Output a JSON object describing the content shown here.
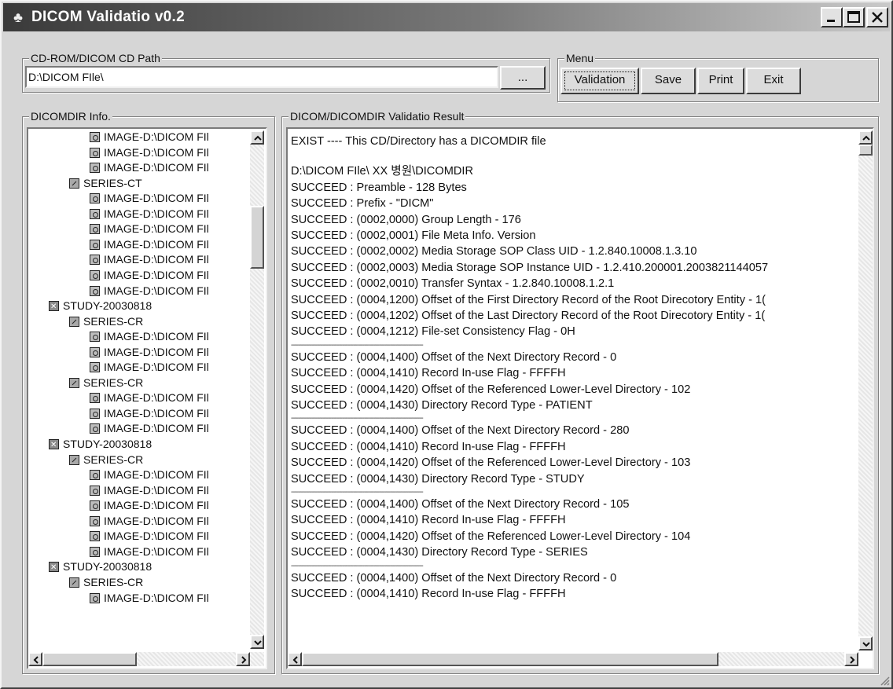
{
  "window": {
    "title": "DICOM Validatio v0.2"
  },
  "path_group": {
    "label": "CD-ROM/DICOM CD Path",
    "path_value": "D:\\DICOM FIle\\",
    "browse_label": "..."
  },
  "menu_group": {
    "label": "Menu",
    "validation_label": "Validation",
    "save_label": "Save",
    "print_label": "Print",
    "exit_label": "Exit"
  },
  "dicomdir_group": {
    "label": "DICOMDIR Info.",
    "items": [
      {
        "type": "image",
        "indent": 2,
        "label": "IMAGE-D:\\DICOM FIl"
      },
      {
        "type": "image",
        "indent": 2,
        "label": "IMAGE-D:\\DICOM FIl"
      },
      {
        "type": "image",
        "indent": 2,
        "label": "IMAGE-D:\\DICOM FIl"
      },
      {
        "type": "series",
        "indent": 1,
        "label": "SERIES-CT"
      },
      {
        "type": "image",
        "indent": 2,
        "label": "IMAGE-D:\\DICOM FIl"
      },
      {
        "type": "image",
        "indent": 2,
        "label": "IMAGE-D:\\DICOM FIl"
      },
      {
        "type": "image",
        "indent": 2,
        "label": "IMAGE-D:\\DICOM FIl"
      },
      {
        "type": "image",
        "indent": 2,
        "label": "IMAGE-D:\\DICOM FIl"
      },
      {
        "type": "image",
        "indent": 2,
        "label": "IMAGE-D:\\DICOM FIl"
      },
      {
        "type": "image",
        "indent": 2,
        "label": "IMAGE-D:\\DICOM FIl"
      },
      {
        "type": "image",
        "indent": 2,
        "label": "IMAGE-D:\\DICOM FIl"
      },
      {
        "type": "study",
        "indent": 0,
        "label": "STUDY-20030818"
      },
      {
        "type": "series",
        "indent": 1,
        "label": "SERIES-CR"
      },
      {
        "type": "image",
        "indent": 2,
        "label": "IMAGE-D:\\DICOM FIl"
      },
      {
        "type": "image",
        "indent": 2,
        "label": "IMAGE-D:\\DICOM FIl"
      },
      {
        "type": "image",
        "indent": 2,
        "label": "IMAGE-D:\\DICOM FIl"
      },
      {
        "type": "series",
        "indent": 1,
        "label": "SERIES-CR"
      },
      {
        "type": "image",
        "indent": 2,
        "label": "IMAGE-D:\\DICOM FIl"
      },
      {
        "type": "image",
        "indent": 2,
        "label": "IMAGE-D:\\DICOM FIl"
      },
      {
        "type": "image",
        "indent": 2,
        "label": "IMAGE-D:\\DICOM FIl"
      },
      {
        "type": "study",
        "indent": 0,
        "label": "STUDY-20030818"
      },
      {
        "type": "series",
        "indent": 1,
        "label": "SERIES-CR"
      },
      {
        "type": "image",
        "indent": 2,
        "label": "IMAGE-D:\\DICOM FIl"
      },
      {
        "type": "image",
        "indent": 2,
        "label": "IMAGE-D:\\DICOM FIl"
      },
      {
        "type": "image",
        "indent": 2,
        "label": "IMAGE-D:\\DICOM FIl"
      },
      {
        "type": "image",
        "indent": 2,
        "label": "IMAGE-D:\\DICOM FIl"
      },
      {
        "type": "image",
        "indent": 2,
        "label": "IMAGE-D:\\DICOM FIl"
      },
      {
        "type": "image",
        "indent": 2,
        "label": "IMAGE-D:\\DICOM FIl"
      },
      {
        "type": "study",
        "indent": 0,
        "label": "STUDY-20030818"
      },
      {
        "type": "series",
        "indent": 1,
        "label": "SERIES-CR"
      },
      {
        "type": "image",
        "indent": 2,
        "label": "IMAGE-D:\\DICOM FIl"
      }
    ]
  },
  "result_group": {
    "label": "DICOM/DICOMDIR Validatio Result",
    "lines": [
      {
        "kind": "text",
        "text": "EXIST ---- This CD/Directory has a DICOMDIR file"
      },
      {
        "kind": "blank",
        "text": ""
      },
      {
        "kind": "text",
        "text": "D:\\DICOM FIle\\ XX 병원\\DICOMDIR"
      },
      {
        "kind": "text",
        "text": "SUCCEED : Preamble - 128 Bytes"
      },
      {
        "kind": "text",
        "text": "SUCCEED : Prefix - \"DICM\""
      },
      {
        "kind": "text",
        "text": "SUCCEED : (0002,0000) Group Length - 176"
      },
      {
        "kind": "text",
        "text": "SUCCEED : (0002,0001) File Meta Info. Version"
      },
      {
        "kind": "text",
        "text": "SUCCEED : (0002,0002) Media Storage SOP Class UID - 1.2.840.10008.1.3.10"
      },
      {
        "kind": "text",
        "text": "SUCCEED : (0002,0003) Media Storage SOP Instance UID - 1.2.410.200001.2003821144057"
      },
      {
        "kind": "text",
        "text": "SUCCEED : (0002,0010) Transfer Syntax - 1.2.840.10008.1.2.1"
      },
      {
        "kind": "text",
        "text": "SUCCEED : (0004,1200) Offset of the First Directory Record of the Root Direcotory Entity - 1("
      },
      {
        "kind": "text",
        "text": "SUCCEED : (0004,1202) Offset of the Last Directory Record of the Root Direcotory Entity - 1("
      },
      {
        "kind": "text",
        "text": "SUCCEED : (0004,1212) File-set Consistency Flag - 0H"
      },
      {
        "kind": "sep",
        "text": "------------------------------------------------------------------------"
      },
      {
        "kind": "text",
        "text": "SUCCEED : (0004,1400) Offset of the Next Directory Record - 0"
      },
      {
        "kind": "text",
        "text": "SUCCEED : (0004,1410) Record In-use Flag - FFFFH"
      },
      {
        "kind": "text",
        "text": "SUCCEED : (0004,1420) Offset of the Referenced Lower-Level Directory - 102"
      },
      {
        "kind": "text",
        "text": "SUCCEED : (0004,1430) Directory Record Type - PATIENT"
      },
      {
        "kind": "sep",
        "text": "------------------------------------------------------------------------"
      },
      {
        "kind": "text",
        "text": "SUCCEED : (0004,1400) Offset of the Next Directory Record - 280"
      },
      {
        "kind": "text",
        "text": "SUCCEED : (0004,1410) Record In-use Flag - FFFFH"
      },
      {
        "kind": "text",
        "text": "SUCCEED : (0004,1420) Offset of the Referenced Lower-Level Directory - 103"
      },
      {
        "kind": "text",
        "text": "SUCCEED : (0004,1430) Directory Record Type - STUDY"
      },
      {
        "kind": "sep",
        "text": "------------------------------------------------------------------------"
      },
      {
        "kind": "text",
        "text": "SUCCEED : (0004,1400) Offset of the Next Directory Record - 105"
      },
      {
        "kind": "text",
        "text": "SUCCEED : (0004,1410) Record In-use Flag - FFFFH"
      },
      {
        "kind": "text",
        "text": "SUCCEED : (0004,1420) Offset of the Referenced Lower-Level Directory - 104"
      },
      {
        "kind": "text",
        "text": "SUCCEED : (0004,1430) Directory Record Type - SERIES"
      },
      {
        "kind": "sep",
        "text": "------------------------------------------------------------------------"
      },
      {
        "kind": "text",
        "text": "SUCCEED : (0004,1400) Offset of the Next Directory Record - 0"
      },
      {
        "kind": "text",
        "text": "SUCCEED : (0004,1410) Record In-use Flag - FFFFH"
      }
    ]
  },
  "icons": {
    "app": "dicom-app-icon",
    "tree_image": "image-node-icon",
    "tree_series": "series-node-icon",
    "tree_study": "study-node-icon"
  },
  "colors": {
    "title_bar_start": "#3a3a3a",
    "title_bar_end": "#c9c9c9",
    "window_face": "#d6d6d6",
    "panel_bg": "#ffffff"
  }
}
